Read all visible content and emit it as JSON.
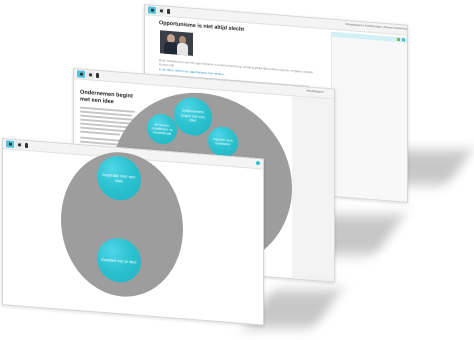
{
  "colors": {
    "accent": "#2cc2cf",
    "gray_disc": "#9d9d9d",
    "panel_border": "#d6d6d6"
  },
  "back_window": {
    "title": "Opportunisme is niet altijd slecht",
    "intro": "Deze situaties kan aan het opportunisme in ondernemerschap, terwijl tegelijkertijd anderen juist de vergeten aanpak kunnen zijn",
    "link_text": "in de video vertelt hoe opportunisme kan werken",
    "tab_labels": [
      "Inhoudsopgave",
      "Aantekeningen",
      "Nieuwe aantekening"
    ],
    "icons": [
      "user-icon",
      "list-icon",
      "pen-icon"
    ]
  },
  "middle_window": {
    "title": "Ondernemen begint met een idee",
    "body_lines": 14,
    "tab_label": "Inhoudsopgave",
    "bubbles": [
      "Ondernemers begint met een idee",
      "Je moeten ontwikkelen op verschillende",
      "Inspelen op je kwaliteiten"
    ],
    "icons": [
      "home-icon",
      "chat-icon",
      "person-icon"
    ]
  },
  "front_window": {
    "bubbles": [
      "Inspiratie voor een idee",
      "Kwaliteit van je idee"
    ],
    "icons": [
      "home-icon",
      "chat-icon",
      "person-icon"
    ]
  }
}
